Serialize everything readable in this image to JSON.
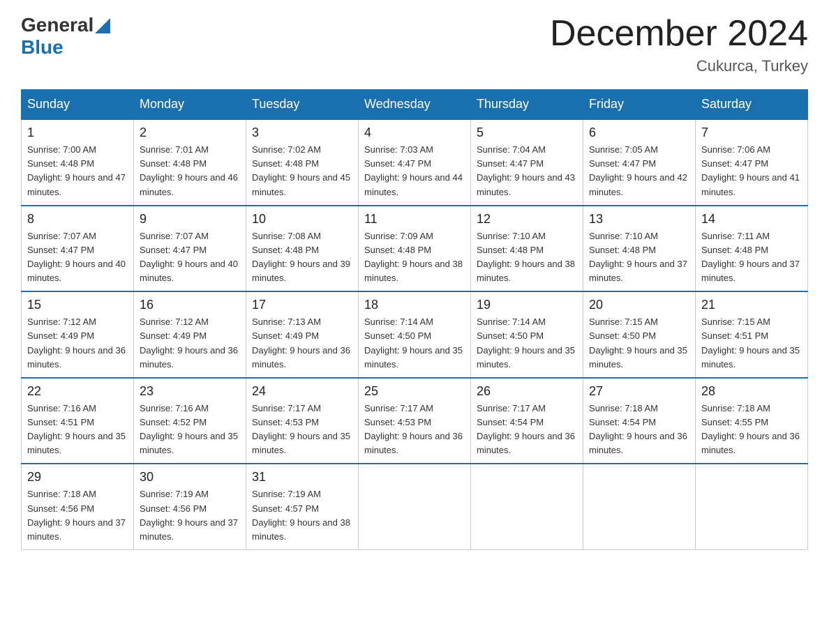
{
  "header": {
    "logo": {
      "general": "General",
      "blue": "Blue"
    },
    "title": "December 2024",
    "location": "Cukurca, Turkey"
  },
  "days_of_week": [
    "Sunday",
    "Monday",
    "Tuesday",
    "Wednesday",
    "Thursday",
    "Friday",
    "Saturday"
  ],
  "weeks": [
    [
      {
        "day": "1",
        "sunrise": "7:00 AM",
        "sunset": "4:48 PM",
        "daylight": "9 hours and 47 minutes."
      },
      {
        "day": "2",
        "sunrise": "7:01 AM",
        "sunset": "4:48 PM",
        "daylight": "9 hours and 46 minutes."
      },
      {
        "day": "3",
        "sunrise": "7:02 AM",
        "sunset": "4:48 PM",
        "daylight": "9 hours and 45 minutes."
      },
      {
        "day": "4",
        "sunrise": "7:03 AM",
        "sunset": "4:47 PM",
        "daylight": "9 hours and 44 minutes."
      },
      {
        "day": "5",
        "sunrise": "7:04 AM",
        "sunset": "4:47 PM",
        "daylight": "9 hours and 43 minutes."
      },
      {
        "day": "6",
        "sunrise": "7:05 AM",
        "sunset": "4:47 PM",
        "daylight": "9 hours and 42 minutes."
      },
      {
        "day": "7",
        "sunrise": "7:06 AM",
        "sunset": "4:47 PM",
        "daylight": "9 hours and 41 minutes."
      }
    ],
    [
      {
        "day": "8",
        "sunrise": "7:07 AM",
        "sunset": "4:47 PM",
        "daylight": "9 hours and 40 minutes."
      },
      {
        "day": "9",
        "sunrise": "7:07 AM",
        "sunset": "4:47 PM",
        "daylight": "9 hours and 40 minutes."
      },
      {
        "day": "10",
        "sunrise": "7:08 AM",
        "sunset": "4:48 PM",
        "daylight": "9 hours and 39 minutes."
      },
      {
        "day": "11",
        "sunrise": "7:09 AM",
        "sunset": "4:48 PM",
        "daylight": "9 hours and 38 minutes."
      },
      {
        "day": "12",
        "sunrise": "7:10 AM",
        "sunset": "4:48 PM",
        "daylight": "9 hours and 38 minutes."
      },
      {
        "day": "13",
        "sunrise": "7:10 AM",
        "sunset": "4:48 PM",
        "daylight": "9 hours and 37 minutes."
      },
      {
        "day": "14",
        "sunrise": "7:11 AM",
        "sunset": "4:48 PM",
        "daylight": "9 hours and 37 minutes."
      }
    ],
    [
      {
        "day": "15",
        "sunrise": "7:12 AM",
        "sunset": "4:49 PM",
        "daylight": "9 hours and 36 minutes."
      },
      {
        "day": "16",
        "sunrise": "7:12 AM",
        "sunset": "4:49 PM",
        "daylight": "9 hours and 36 minutes."
      },
      {
        "day": "17",
        "sunrise": "7:13 AM",
        "sunset": "4:49 PM",
        "daylight": "9 hours and 36 minutes."
      },
      {
        "day": "18",
        "sunrise": "7:14 AM",
        "sunset": "4:50 PM",
        "daylight": "9 hours and 35 minutes."
      },
      {
        "day": "19",
        "sunrise": "7:14 AM",
        "sunset": "4:50 PM",
        "daylight": "9 hours and 35 minutes."
      },
      {
        "day": "20",
        "sunrise": "7:15 AM",
        "sunset": "4:50 PM",
        "daylight": "9 hours and 35 minutes."
      },
      {
        "day": "21",
        "sunrise": "7:15 AM",
        "sunset": "4:51 PM",
        "daylight": "9 hours and 35 minutes."
      }
    ],
    [
      {
        "day": "22",
        "sunrise": "7:16 AM",
        "sunset": "4:51 PM",
        "daylight": "9 hours and 35 minutes."
      },
      {
        "day": "23",
        "sunrise": "7:16 AM",
        "sunset": "4:52 PM",
        "daylight": "9 hours and 35 minutes."
      },
      {
        "day": "24",
        "sunrise": "7:17 AM",
        "sunset": "4:53 PM",
        "daylight": "9 hours and 35 minutes."
      },
      {
        "day": "25",
        "sunrise": "7:17 AM",
        "sunset": "4:53 PM",
        "daylight": "9 hours and 36 minutes."
      },
      {
        "day": "26",
        "sunrise": "7:17 AM",
        "sunset": "4:54 PM",
        "daylight": "9 hours and 36 minutes."
      },
      {
        "day": "27",
        "sunrise": "7:18 AM",
        "sunset": "4:54 PM",
        "daylight": "9 hours and 36 minutes."
      },
      {
        "day": "28",
        "sunrise": "7:18 AM",
        "sunset": "4:55 PM",
        "daylight": "9 hours and 36 minutes."
      }
    ],
    [
      {
        "day": "29",
        "sunrise": "7:18 AM",
        "sunset": "4:56 PM",
        "daylight": "9 hours and 37 minutes."
      },
      {
        "day": "30",
        "sunrise": "7:19 AM",
        "sunset": "4:56 PM",
        "daylight": "9 hours and 37 minutes."
      },
      {
        "day": "31",
        "sunrise": "7:19 AM",
        "sunset": "4:57 PM",
        "daylight": "9 hours and 38 minutes."
      },
      null,
      null,
      null,
      null
    ]
  ]
}
